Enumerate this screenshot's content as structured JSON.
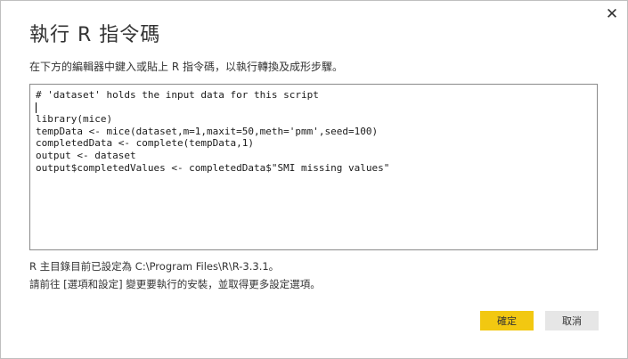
{
  "dialog": {
    "title": "執行 R 指令碼",
    "close_glyph": "✕",
    "instruction": "在下方的編輯器中鍵入或貼上 R 指令碼，以執行轉換及成形步驟。",
    "code_lines": [
      "# 'dataset' holds the input data for this script",
      "",
      "library(mice)",
      "tempData <- mice(dataset,m=1,maxit=50,meth='pmm',seed=100)",
      "completedData <- complete(tempData,1)",
      "output <- dataset",
      "output$completedValues <- completedData$\"SMI missing values\""
    ],
    "r_home_info": "R 主目錄目前已設定為 C:\\Program Files\\R\\R-3.3.1。",
    "settings_info": "請前往 [選項和設定] 變更要執行的安裝，並取得更多設定選項。",
    "ok_label": "確定",
    "cancel_label": "取消",
    "colors": {
      "ok_button": "#f2c811",
      "cancel_button": "#e6e6e6"
    }
  }
}
